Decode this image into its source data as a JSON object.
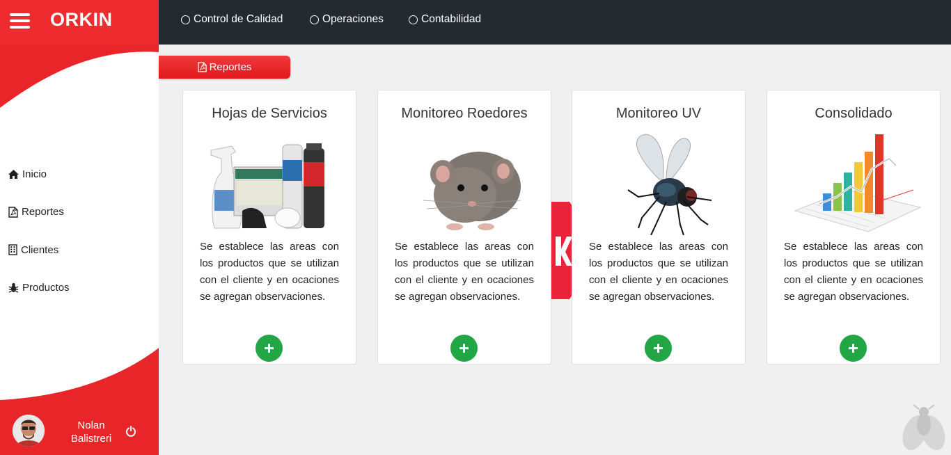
{
  "app": {
    "brand": "ORKIN"
  },
  "colors": {
    "brand_red": "#e8262a",
    "topbar": "#232b30",
    "add_green": "#22a645"
  },
  "topbar": {
    "links": [
      {
        "label": "Control de Calidad"
      },
      {
        "label": "Operaciones"
      },
      {
        "label": "Contabilidad"
      }
    ]
  },
  "sidebar": {
    "items": [
      {
        "label": "Inicio",
        "icon": "home-icon"
      },
      {
        "label": "Reportes",
        "icon": "file-pdf-icon"
      },
      {
        "label": "Clientes",
        "icon": "building-icon"
      },
      {
        "label": "Productos",
        "icon": "bug-icon"
      }
    ],
    "user": {
      "first_name": "Nolan",
      "last_name": "Balistreri"
    }
  },
  "tab": {
    "label": "Reportes"
  },
  "cards": [
    {
      "title": "Hojas de Servicios",
      "image": "pest-control-products-image",
      "text": "Se establece las areas con los productos que se utilizan con el cliente y en ocaciones se agregan observaciones."
    },
    {
      "title": "Monitoreo Roedores",
      "image": "rat-image",
      "text": "Se establece las areas con los productos que se utilizan con el cliente y en ocaciones se agregan observaciones."
    },
    {
      "title": "Monitoreo UV",
      "image": "fly-image",
      "text": "Se establece las areas con los productos que se utilizan con el cliente y en ocaciones se agregan observaciones."
    },
    {
      "title": "Consolidado",
      "image": "bar-chart-image",
      "text": "Se establece las areas con los productos que se utilizan con el cliente y en ocaciones se agregan observaciones."
    }
  ]
}
